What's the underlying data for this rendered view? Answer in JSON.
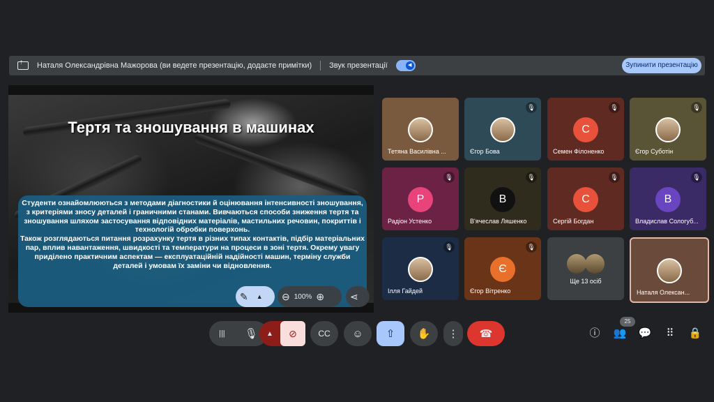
{
  "topbar": {
    "title": "Наталя Олександрівна Мажорова (ви ведете презентацію, додаєте примітки)",
    "sound_label": "Звук презентації",
    "stop_button": "Зупинити презентацію"
  },
  "slide": {
    "title": "Тертя та зношування в машинах",
    "description": "Студенти ознайомлюються з методами діагностики й оцінювання інтенсивності зношування, з критеріями зносу деталей і граничними станами. Вивчаються способи зниження тертя та зношування шляхом застосування відповідних матеріалів, мастильних речовин, покриттів і технологій обробки поверхонь.\nТакож розглядаються питання розрахунку тертя в різних типах контактів, підбір матеріальних пар, вплив навантаження, швидкості та температури на процеси в зоні тертя. Окрему увагу приділено практичним аспектам — експлуатаційній надійності машин, терміну служби деталей і умовам їх заміни чи відновлення.",
    "zoom": "100%"
  },
  "participants": [
    {
      "name": "Тетяна Василівна ...",
      "avatar": "",
      "color": "#7a5a3e",
      "muted": false
    },
    {
      "name": "Єгор Бова",
      "avatar": "",
      "color": "#2e4a57",
      "muted": true
    },
    {
      "name": "Семен Філоненко",
      "avatar": "С",
      "color": "#5e2a22",
      "avatar_color": "#e8513a",
      "muted": true
    },
    {
      "name": "Єгор Суботін",
      "avatar": "",
      "color": "#5a5436",
      "muted": true
    },
    {
      "name": "Радіон Устенко",
      "avatar": "Р",
      "color": "#6b2244",
      "avatar_color": "#e8437a",
      "muted": true
    },
    {
      "name": "В'ячеслав Ляшенко",
      "avatar": "В",
      "color": "#2f2c1d",
      "avatar_color": "#111111",
      "muted": true
    },
    {
      "name": "Сергій Богдан",
      "avatar": "С",
      "color": "#5e2a22",
      "avatar_color": "#e8513a",
      "muted": true
    },
    {
      "name": "Владислав Сологуб...",
      "avatar": "В",
      "color": "#3a2a66",
      "avatar_color": "#6a45c0",
      "muted": true
    },
    {
      "name": "Ілля Гайдей",
      "avatar": "",
      "color": "#1c2c45",
      "muted": true
    },
    {
      "name": "Єгор Вітренко",
      "avatar": "Є",
      "color": "#6a3418",
      "avatar_color": "#e8702a",
      "muted": true
    },
    {
      "name": "Ще 13 осіб",
      "avatar": "",
      "color": "#3c4043",
      "muted": false
    },
    {
      "name": "Наталя Олексан...",
      "avatar": "",
      "color": "#6a4a3a",
      "muted": false
    }
  ],
  "participants_count": "25",
  "icons": {
    "present": "present-icon",
    "mic": "mic-icon",
    "camera_off": "camera-off-icon",
    "captions": "captions-icon",
    "emoji": "emoji-icon",
    "present_now": "present-now-icon",
    "raise_hand": "raise-hand-icon",
    "more": "more-options-icon",
    "end_call": "end-call-icon",
    "info": "info-icon",
    "people": "people-icon",
    "chat": "chat-icon",
    "activities": "activities-icon",
    "host_controls": "host-controls-icon"
  }
}
